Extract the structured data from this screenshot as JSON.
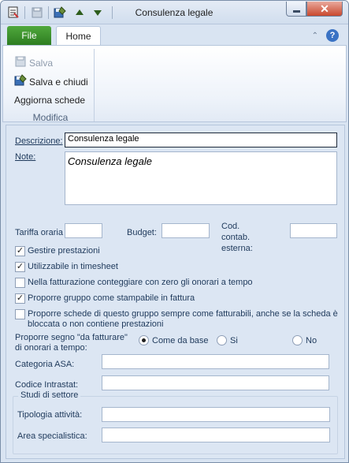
{
  "window": {
    "title": "Consulenza legale"
  },
  "tabs": {
    "file": "File",
    "home": "Home"
  },
  "ribbon": {
    "save": "Salva",
    "save_close": "Salva e chiudi",
    "refresh": "Aggiorna schede",
    "group_label": "Modifica"
  },
  "form": {
    "descrizione_label": "Descrizione:",
    "descrizione_value": "Consulenza legale",
    "note_label": "Note:",
    "note_value": "Consulenza legale",
    "tariffa_label": "Tariffa oraria",
    "budget_label": "Budget:",
    "cod_label_1": "Cod.",
    "cod_label_2": "contab.",
    "cod_label_3": "esterna:",
    "checkboxes": [
      {
        "label": "Gestire prestazioni",
        "checked": true
      },
      {
        "label": "Utilizzabile in timesheet",
        "checked": true
      },
      {
        "label": "Nella fatturazione conteggiare con zero gli onorari a tempo",
        "checked": false
      },
      {
        "label": "Proporre gruppo come stampabile in fattura",
        "checked": true
      },
      {
        "label_line1": "Proporre schede di questo gruppo sempre come fatturabili, anche se la scheda è",
        "label_line2": "bloccata o non contiene prestazioni",
        "checked": false
      }
    ],
    "proporre_label_1": "Proporre segno \"da fatturare\"",
    "proporre_label_2": "di onorari a tempo:",
    "radios": [
      {
        "label": "Come da base",
        "selected": true
      },
      {
        "label": "Si",
        "selected": false
      },
      {
        "label": "No",
        "selected": false
      }
    ],
    "categoria_label": "Categoria ASA:",
    "codice_label": "Codice Intrastat:",
    "studi_title": "Studi di settore",
    "tipologia_label": "Tipologia attività:",
    "area_label": "Area specialistica:"
  },
  "colors": {
    "file_tab": "#2e7d21",
    "accent": "#1e395b",
    "close": "#c9482e"
  }
}
